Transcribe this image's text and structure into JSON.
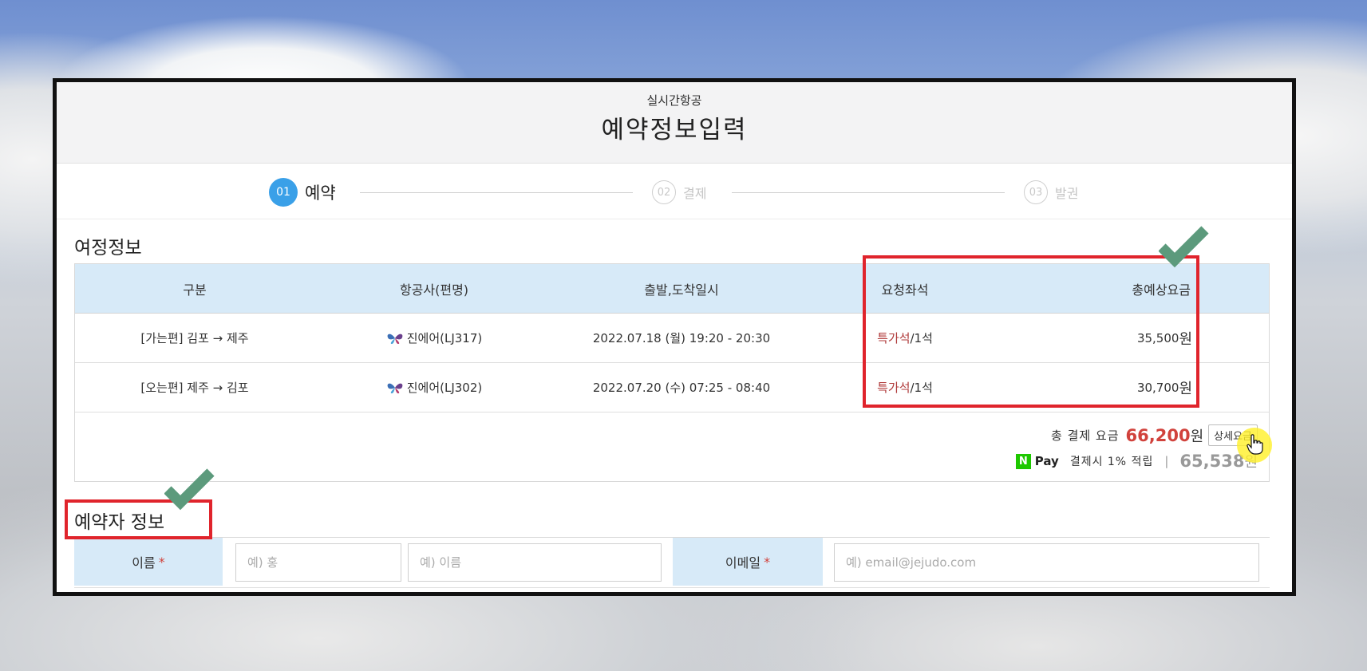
{
  "header": {
    "subtitle": "실시간항공",
    "title": "예약정보입력"
  },
  "steps": [
    {
      "num": "01",
      "label": "예약",
      "state": "active"
    },
    {
      "num": "02",
      "label": "결제",
      "state": "inactive"
    },
    {
      "num": "03",
      "label": "발권",
      "state": "inactive"
    }
  ],
  "itinerary": {
    "section_title": "여정정보",
    "columns": [
      "구분",
      "항공사(편명)",
      "출발,도착일시",
      "요청좌석",
      "총예상요금"
    ],
    "rows": [
      {
        "route": "[가는편] 김포 → 제주",
        "flight": "진에어(LJ317)",
        "datetime": "2022.07.18 (월) 19:20 - 20:30",
        "seat_class": "특가석",
        "seat_count": "/1석",
        "price": "35,500",
        "unit": "원"
      },
      {
        "route": "[오는편] 제주 → 김포",
        "flight": "진에어(LJ302)",
        "datetime": "2022.07.20 (수) 07:25 - 08:40",
        "seat_class": "특가석",
        "seat_count": "/1석",
        "price": "30,700",
        "unit": "원"
      }
    ],
    "total_label": "총 결제 요금",
    "total_amount": "66,200",
    "total_unit": "원",
    "detail_button": "상세요금",
    "npay_logo": "N",
    "npay_text": "Pay",
    "npay_desc": "결제시 1% 적립",
    "npay_sep": "|",
    "npay_amount": "65,538",
    "npay_unit": "원"
  },
  "booker": {
    "section_title": "예약자 정보",
    "name_label": "이름",
    "required_mark": "*",
    "surname_placeholder": "예) 홍",
    "given_placeholder": "예) 이름",
    "email_label": "이메일",
    "email_placeholder": "예) email@jejudo.com"
  },
  "colors": {
    "accent_blue": "#3aa0e8",
    "header_blue": "#d7eaf8",
    "price_red": "#d1423c",
    "annotation_red": "#e0242c",
    "check_green": "#5c9a7c",
    "npay_green": "#1ec800"
  }
}
